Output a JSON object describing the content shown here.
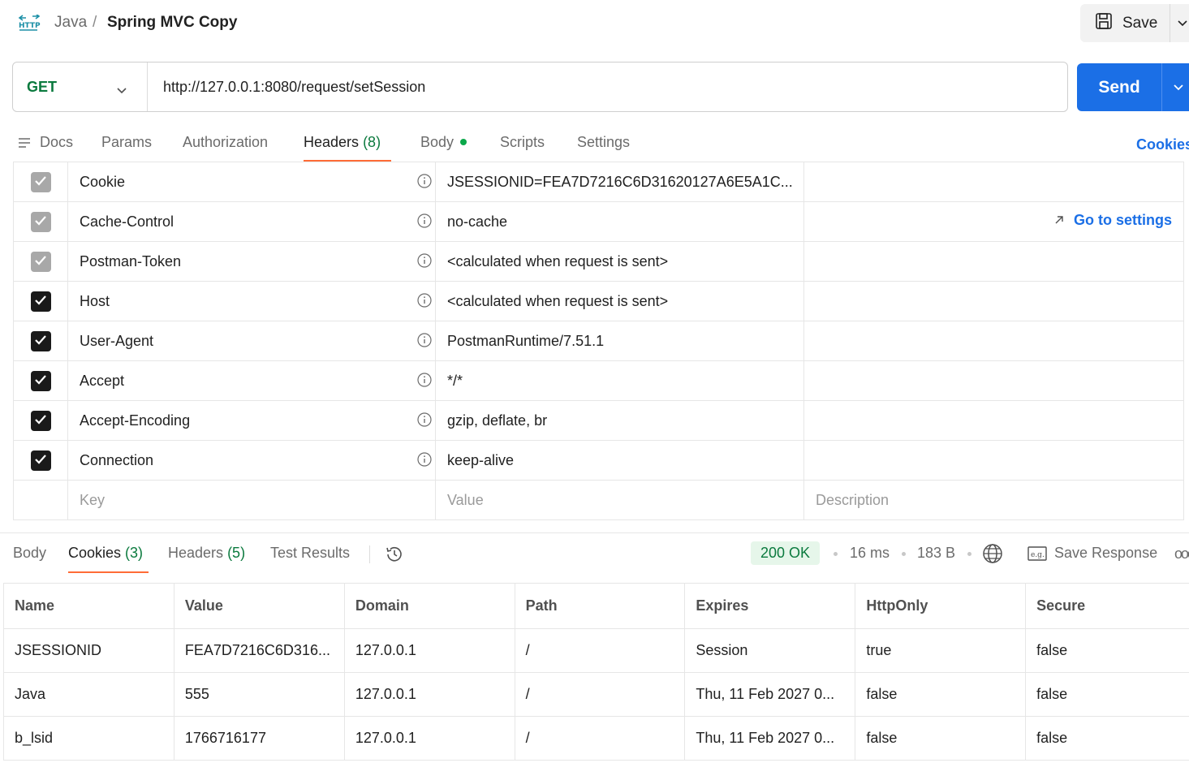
{
  "breadcrumb": {
    "parent": "Java",
    "separator": "/",
    "title": "Spring MVC Copy"
  },
  "toolbar": {
    "save_label": "Save"
  },
  "request": {
    "method": "GET",
    "url": "http://127.0.0.1:8080/request/setSession",
    "send_label": "Send"
  },
  "req_tabs": {
    "docs": "Docs",
    "params": "Params",
    "authorization": "Authorization",
    "headers": "Headers",
    "headers_count": "(8)",
    "body": "Body",
    "scripts": "Scripts",
    "settings": "Settings",
    "cookies": "Cookies"
  },
  "headers": {
    "rows": [
      {
        "key": "Cookie",
        "value": "JSESSIONID=FEA7D7216C6D31620127A6E5A1C...",
        "state": "auto"
      },
      {
        "key": "Cache-Control",
        "value": "no-cache",
        "state": "auto"
      },
      {
        "key": "Postman-Token",
        "value": "<calculated when request is sent>",
        "state": "auto"
      },
      {
        "key": "Host",
        "value": "<calculated when request is sent>",
        "state": "checked"
      },
      {
        "key": "User-Agent",
        "value": "PostmanRuntime/7.51.1",
        "state": "checked"
      },
      {
        "key": "Accept",
        "value": "*/*",
        "state": "checked"
      },
      {
        "key": "Accept-Encoding",
        "value": "gzip, deflate, br",
        "state": "checked"
      },
      {
        "key": "Connection",
        "value": "keep-alive",
        "state": "checked"
      }
    ],
    "goto_settings": "Go to settings",
    "placeholder_key": "Key",
    "placeholder_value": "Value",
    "placeholder_description": "Description"
  },
  "response": {
    "tabs": {
      "body": "Body",
      "cookies": "Cookies",
      "cookies_count": "(3)",
      "headers": "Headers",
      "headers_count": "(5)",
      "test_results": "Test Results"
    },
    "status": "200 OK",
    "time": "16 ms",
    "size": "183 B",
    "save_response": "Save Response",
    "more": "ooo"
  },
  "cookies_table": {
    "columns": [
      "Name",
      "Value",
      "Domain",
      "Path",
      "Expires",
      "HttpOnly",
      "Secure"
    ],
    "rows": [
      [
        "JSESSIONID",
        "FEA7D7216C6D316...",
        "127.0.0.1",
        "/",
        "Session",
        "true",
        "false"
      ],
      [
        "Java",
        "555",
        "127.0.0.1",
        "/",
        "Thu, 11 Feb 2027 0...",
        "false",
        "false"
      ],
      [
        "b_lsid",
        "1766716177",
        "127.0.0.1",
        "/",
        "Thu, 11 Feb 2027 0...",
        "false",
        "false"
      ]
    ]
  },
  "colors": {
    "accent": "#1b6fe6",
    "method": "#0b7a3e",
    "tab_indicator": "#ff6c37",
    "status_bg": "#e6f6ea"
  },
  "icons": [
    "http-icon",
    "save-icon",
    "chevron-down-icon",
    "docs-icon",
    "info-icon",
    "arrow-up-right-icon",
    "history-icon",
    "globe-icon",
    "example-icon",
    "more-icon"
  ]
}
